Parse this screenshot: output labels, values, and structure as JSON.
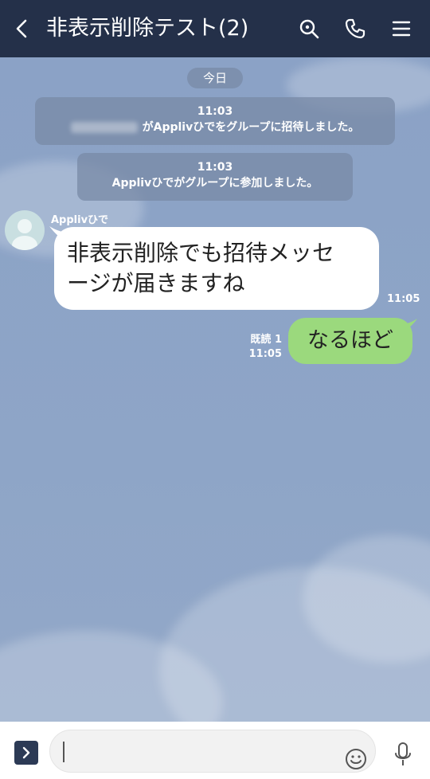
{
  "header": {
    "title": "非表示削除テスト(2)",
    "icons": [
      "chevron-left-icon",
      "search-icon",
      "phone-icon",
      "menu-icon"
    ]
  },
  "chat": {
    "date_label": "今日",
    "system_messages": [
      {
        "time": "11:03",
        "text": "がApplivひでをグループに招待しました。"
      },
      {
        "time": "11:03",
        "text": "Applivひでがグループに参加しました。"
      }
    ],
    "incoming": {
      "sender": "Applivひで",
      "text_line1": "非表示削除でも招待メッセ",
      "text_line2": "ージが届きますね",
      "time": "11:05"
    },
    "outgoing": {
      "read_label": "既読 1",
      "time": "11:05",
      "text": "なるほど"
    }
  },
  "input": {
    "placeholder": "",
    "value": ""
  },
  "colors": {
    "header_bg": "#243049",
    "chat_bg": "#8ea4c6",
    "outgoing_bubble": "#9bd97d",
    "incoming_bubble": "#ffffff"
  }
}
